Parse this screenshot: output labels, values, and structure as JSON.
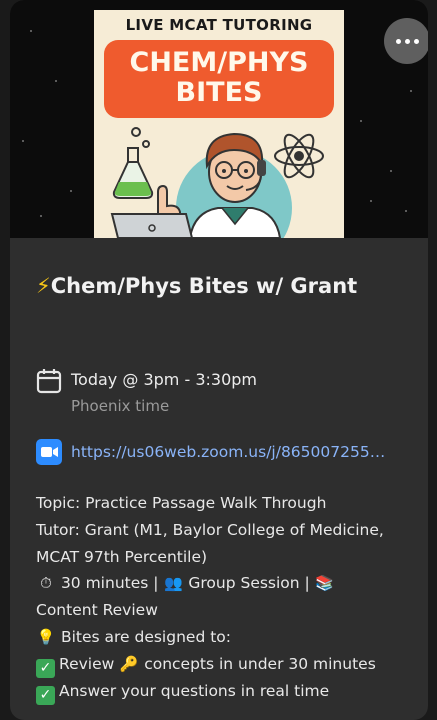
{
  "poster": {
    "top_text": "LIVE MCAT TUTORING",
    "banner_line1": "CHEM/PHYS",
    "banner_line2": "BITES"
  },
  "event": {
    "title_emoji": "⚡",
    "title": "Chem/Phys Bites w/ Grant",
    "when": "Today @ 3pm - 3:30pm",
    "timezone": "Phoenix time",
    "link": "https://us06web.zoom.us/j/865007255…"
  },
  "description": {
    "topic": "Topic: Practice Passage Walk Through",
    "tutor_line1": "Tutor: Grant (M1, Baylor College of Medicine,",
    "tutor_line2": "MCAT 97th Percentile)",
    "duration_emoji": "⏱",
    "duration_text": "30 minutes |",
    "group_emoji": "👥",
    "group_text": "Group Session |",
    "books_emoji": "📚",
    "content_review": "Content Review",
    "bulb_emoji": "💡",
    "bites_intro": "Bites are designed to:",
    "check_glyph": "✓",
    "point1_a": "Review",
    "key_emoji": "🔑",
    "point1_b": "concepts in under 30 minutes",
    "point2": "Answer your questions in real time"
  },
  "icons": {
    "calendar": "calendar-icon",
    "zoom": "zoom-video-icon",
    "more": "more-options-icon"
  },
  "colors": {
    "card_bg": "#2e2e2e",
    "link": "#8ab4f8",
    "zoom_blue": "#2d8cff",
    "banner_orange": "#ef5b2e",
    "check_green": "#3aa757"
  }
}
